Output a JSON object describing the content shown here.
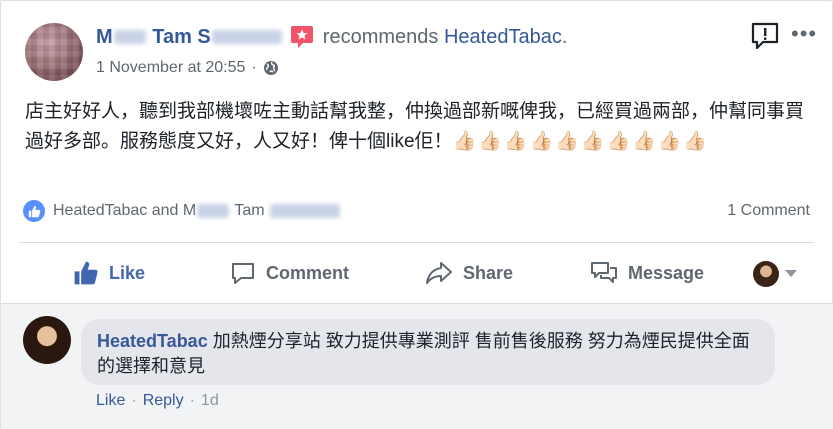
{
  "post": {
    "author_first": "M",
    "author_mid": "Tam S",
    "recommends_text": "recommends",
    "page_name": "HeatedTabac",
    "page_suffix": ".",
    "timestamp": "1 November at 20:55",
    "separator": "·",
    "body": "店主好好人，聽到我部機壞咗主動話幫我整，仲換過部新嘅俾我，已經買過兩部，仲幫同事買過好多部。服務態度又好，人又好！俾十個like佢！",
    "thumbs": "👍🏻👍🏻👍🏻👍🏻👍🏻👍🏻👍🏻👍🏻👍🏻👍🏻"
  },
  "reactions": {
    "names_a": "HeatedTabac and M",
    "names_b": "Tam",
    "comment_count": "1 Comment"
  },
  "actions": {
    "like": "Like",
    "comment": "Comment",
    "share": "Share",
    "message": "Message"
  },
  "comment": {
    "author": "HeatedTabac",
    "text": "加熱煙分享站 致力提供專業測評 售前售後服務 努力為煙民提供全面的選擇和意見",
    "like": "Like",
    "reply": "Reply",
    "dot": "·",
    "age": "1d"
  },
  "colors": {
    "link": "#365899",
    "like_blue": "#4267b2",
    "muted": "#606770",
    "bubble": "#e4e6eb"
  }
}
